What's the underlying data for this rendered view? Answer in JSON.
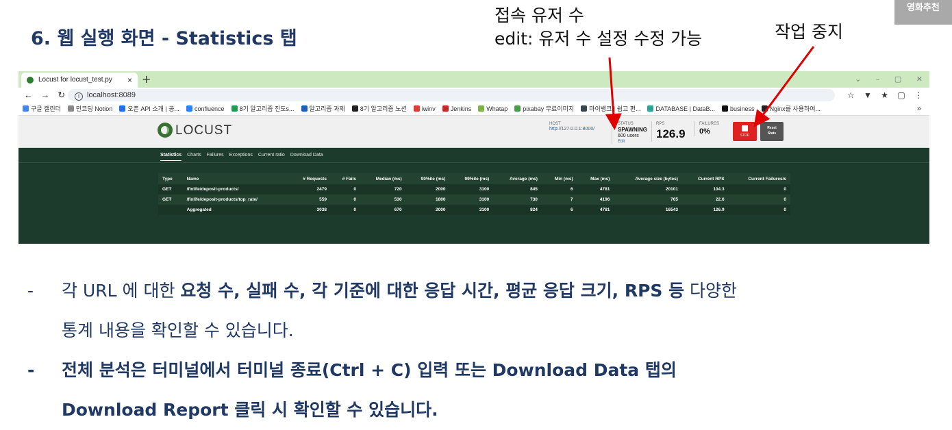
{
  "corner_badge": "영화추천",
  "slide_title": "6. 웹 실행 화면 - Statistics 탭",
  "annotations": {
    "users_line1": "접속 유저 수",
    "users_line2": "edit: 유저 수 설정 수정 가능",
    "stop": "작업 중지"
  },
  "browser": {
    "tab_title": "Locust for locust_test.py",
    "tab_close": "×",
    "new_tab": "+",
    "url": "localhost:8089",
    "bookmarks": [
      "구글 캘린더",
      "민코딩 Notion",
      "오픈 API 소개 | 공...",
      "confluence",
      "8기 알고리즘 진도s...",
      "알고리즘 과제",
      "8기 알고리즘 노션",
      "iwinv",
      "Jenkins",
      "Whatap",
      "pixabay 무료이미지",
      "마이뱅크 | 쉽고 편...",
      "DATABASE | DataB...",
      "business",
      "Nginx를 사용하여..."
    ],
    "bookmark_colors": [
      "#4285f4",
      "#888888",
      "#1a73e8",
      "#2684ff",
      "#1f9d55",
      "#1565c0",
      "#222222",
      "#e53935",
      "#c62828",
      "#7cb342",
      "#43a047",
      "#37474f",
      "#26a69a",
      "#111111",
      "#222222"
    ]
  },
  "locust": {
    "logo_text": "LOCUST",
    "host_label": "HOST",
    "host_value": "http://127.0.0.1:8000/",
    "status_label": "STATUS",
    "status_value": "SPAWNING",
    "users_value": "600 users",
    "edit_link": "Edit",
    "rps_label": "RPS",
    "rps_value": "126.9",
    "failures_label": "FAILURES",
    "failures_value": "0%",
    "stop_label": "STOP",
    "reset_label_1": "Reset",
    "reset_label_2": "Stats",
    "tabs": [
      "Statistics",
      "Charts",
      "Failures",
      "Exceptions",
      "Current ratio",
      "Download Data"
    ],
    "active_tab": "Statistics",
    "columns": [
      "Type",
      "Name",
      "# Requests",
      "# Fails",
      "Median (ms)",
      "90%ile (ms)",
      "99%ile (ms)",
      "Average (ms)",
      "Min (ms)",
      "Max (ms)",
      "Average size (bytes)",
      "Current RPS",
      "Current Failures/s"
    ],
    "rows": [
      [
        "GET",
        "/finlife/deposit-products/",
        "2479",
        "0",
        "720",
        "2000",
        "3100",
        "845",
        "6",
        "4781",
        "20101",
        "104.3",
        "0"
      ],
      [
        "GET",
        "/finlife/deposit-products/top_rate/",
        "559",
        "0",
        "530",
        "1800",
        "3100",
        "730",
        "7",
        "4196",
        "765",
        "22.6",
        "0"
      ],
      [
        "",
        "Aggregated",
        "3038",
        "0",
        "670",
        "2000",
        "3100",
        "824",
        "6",
        "4781",
        "16543",
        "126.9",
        "0"
      ]
    ]
  },
  "bullets": {
    "b1_line1_a": "각 URL 에 대한 ",
    "b1_line1_b": "요청 수, 실패 수, 각 기준에 대한 응답 시간, 평균 응답 크기, RPS 등",
    "b1_line1_c": " 다양한",
    "b1_line2": "통계 내용을 확인할 수 있습니다.",
    "b2_line1": "전체 분석은 터미널에서 터미널 종료(Ctrl + C) 입력 또는 Download Data 탭의",
    "b2_line2": "Download Report 클릭 시 확인할 수 있습니다."
  }
}
